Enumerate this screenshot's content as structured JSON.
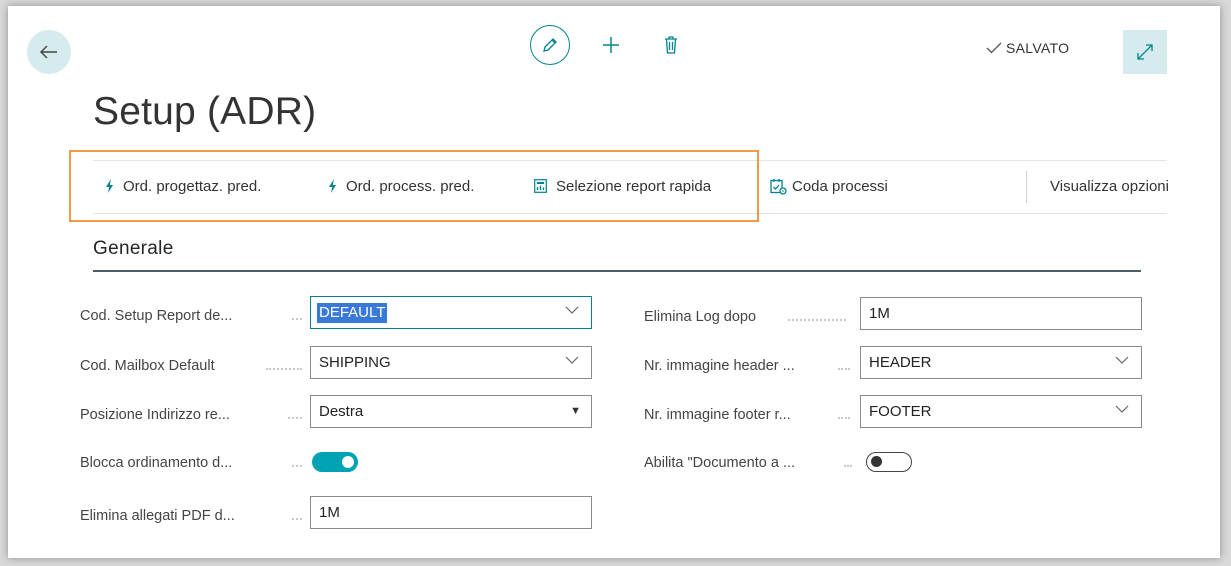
{
  "header": {
    "title": "Setup (ADR)",
    "saved_status": "SALVATO"
  },
  "actions": [
    {
      "label": "Ord. progettaz. pred.",
      "icon": "lightning-icon"
    },
    {
      "label": "Ord. process. pred.",
      "icon": "lightning-icon"
    },
    {
      "label": "Selezione report rapida",
      "icon": "report-icon"
    },
    {
      "label": "Coda processi",
      "icon": "job-queue-icon"
    },
    {
      "label": "Visualizza opzioni"
    }
  ],
  "section": {
    "title": "Generale"
  },
  "fields_left": [
    {
      "label": "Cod. Setup Report de...",
      "value": "DEFAULT",
      "type": "lookup"
    },
    {
      "label": "Cod. Mailbox Default",
      "value": "SHIPPING",
      "type": "lookup"
    },
    {
      "label": "Posizione Indirizzo re...",
      "value": "Destra",
      "type": "option"
    },
    {
      "label": "Blocca ordinamento d...",
      "value": "true",
      "type": "toggle"
    },
    {
      "label": "Elimina allegati PDF d...",
      "value": "1M",
      "type": "text"
    }
  ],
  "fields_right": [
    {
      "label": "Elimina Log dopo",
      "value": "1M",
      "type": "text"
    },
    {
      "label": "Nr. immagine header ...",
      "value": "HEADER",
      "type": "lookup"
    },
    {
      "label": "Nr. immagine footer r...",
      "value": "FOOTER",
      "type": "lookup"
    },
    {
      "label": "Abilita \"Documento a ...",
      "value": "false",
      "type": "toggle"
    }
  ],
  "colors": {
    "accent": "#00838f",
    "toggle_on": "#00a3b4",
    "highlight_box": "#ef9a4b",
    "selection": "#3879d9",
    "button_bg": "#d6ebee"
  }
}
